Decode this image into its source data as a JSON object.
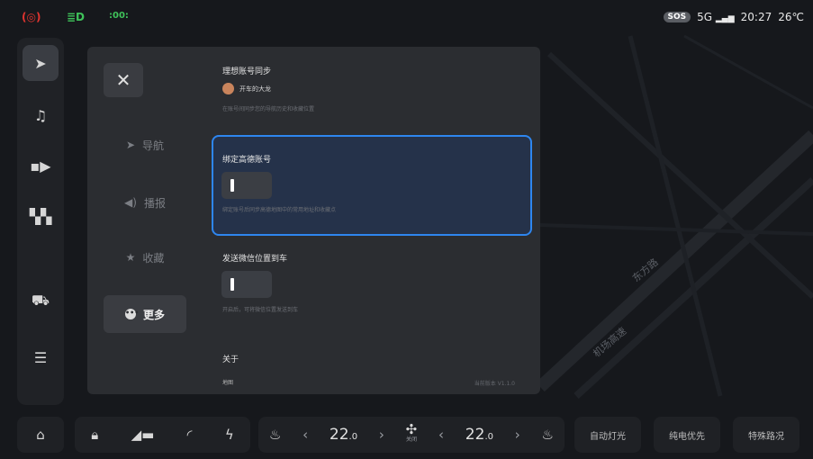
{
  "status_bar": {
    "icons": [
      "warning-icon",
      "headlight-icon",
      "position-light-icon"
    ],
    "sos": "SOS",
    "network": "5G",
    "time": "20:27",
    "temperature": "26℃"
  },
  "left_rail": {
    "items": [
      {
        "name": "navigation",
        "icon": "navigation-icon",
        "active": true
      },
      {
        "name": "music",
        "icon": "music-icon",
        "active": false
      },
      {
        "name": "video",
        "icon": "video-icon",
        "active": false
      },
      {
        "name": "apps",
        "icon": "apps-icon",
        "active": false
      },
      {
        "name": "car",
        "icon": "car-icon",
        "active": false
      },
      {
        "name": "controls",
        "icon": "controls-icon",
        "active": false
      }
    ]
  },
  "settings_panel": {
    "close_label": "✕",
    "nav": [
      {
        "label": "导航",
        "icon": "navigation-icon",
        "active": false
      },
      {
        "label": "播报",
        "icon": "speaker-icon",
        "active": false
      },
      {
        "label": "收藏",
        "icon": "star-icon",
        "active": false
      },
      {
        "label": "更多",
        "icon": "more-icon",
        "active": true
      }
    ],
    "sync": {
      "title": "理想账号同步",
      "account_name": "开车的大龙",
      "desc": "在账号间同步您的导航历史和收藏位置"
    },
    "bind": {
      "title": "绑定高德账号",
      "desc": "绑定账号后同步高德地图中的常用地址和收藏点",
      "enabled": false
    },
    "wechat": {
      "title": "发送微信位置到车",
      "desc": "开启后，可将微信位置发送到车",
      "enabled": false
    },
    "about": {
      "title": "关于",
      "item": "地图",
      "version": "当前版本 V1.1.0"
    }
  },
  "map": {
    "road_labels": [
      "东方路",
      "机场高速"
    ]
  },
  "bottom_bar": {
    "home_icon": "home-icon",
    "vehicle_icons": [
      "lock-icon",
      "trunk-icon",
      "wiper-icon",
      "charge-icon"
    ],
    "left_seat_icon": "seat-heat-icon",
    "left_temp": "22",
    "left_temp_decimal": ".0",
    "fan_label": "关闭",
    "right_temp": "22",
    "right_temp_decimal": ".0",
    "right_seat_icon": "seat-heat-icon",
    "quick_buttons": [
      "自动灯光",
      "纯电优先",
      "特殊路况"
    ]
  }
}
